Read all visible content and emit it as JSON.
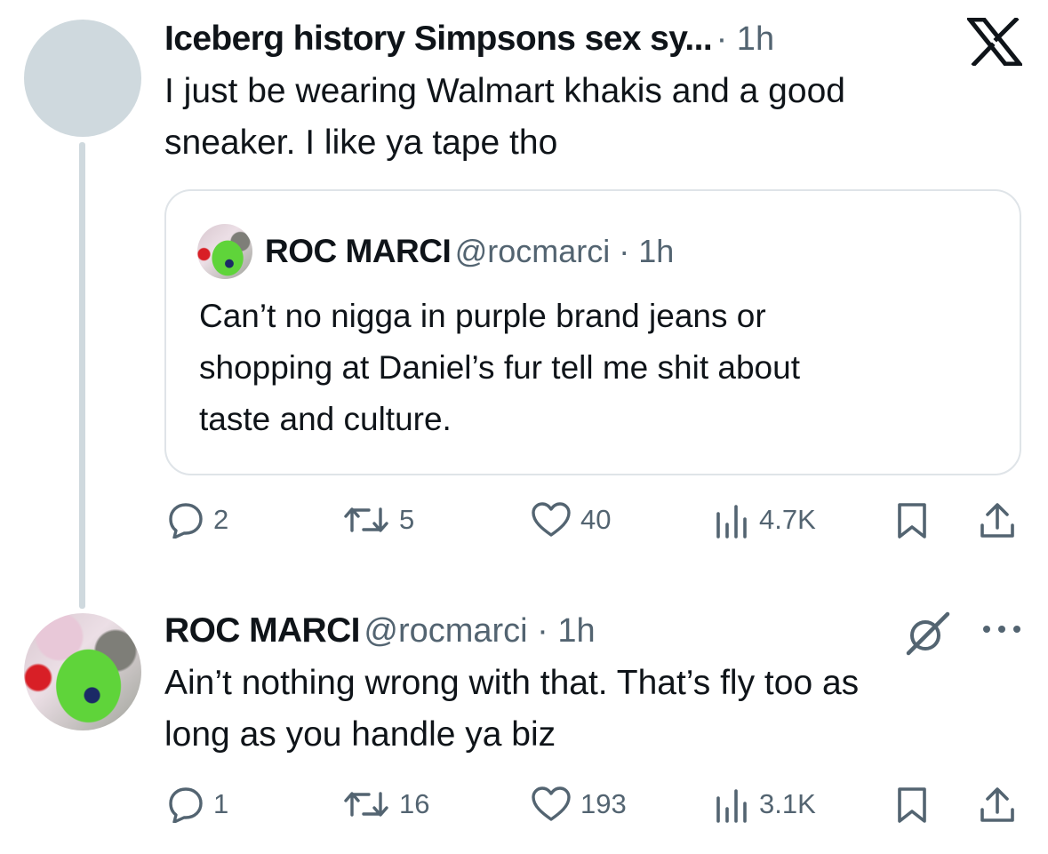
{
  "tweet1": {
    "display_name": "Iceberg history Simpsons sex sy...",
    "meta": "· 1h",
    "text_line1": "I just be wearing Walmart khakis and a good",
    "text_line2": "sneaker. I like ya tape tho",
    "logo": "x-logo-icon",
    "quote": {
      "display_name": "ROC MARCI",
      "meta": "@rocmarci · 1h",
      "text_line1": "Can’t no nigga in purple brand jeans or",
      "text_line2": "shopping at Daniel’s fur tell me shit about",
      "text_line3": "taste and culture."
    },
    "actions": {
      "replies": "2",
      "reposts": "5",
      "likes": "40",
      "views": "4.7K"
    }
  },
  "tweet2": {
    "display_name": "ROC MARCI",
    "meta": "@rocmarci · 1h",
    "text_line1": "Ain’t nothing wrong with that. That’s fly too as",
    "text_line2": "long as you handle ya biz",
    "actions": {
      "replies": "1",
      "reposts": "16",
      "likes": "193",
      "views": "3.1K"
    }
  },
  "colors": {
    "text": "#0f1419",
    "secondary": "#536471",
    "border": "#dfe4e8",
    "line": "#cfd9de"
  }
}
